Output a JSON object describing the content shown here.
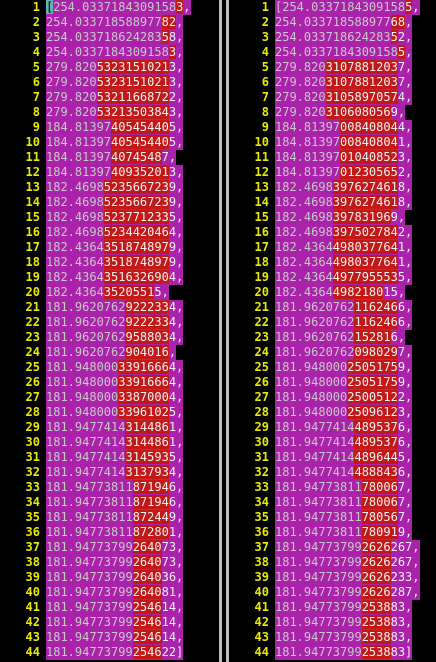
{
  "left": {
    "lines": [
      {
        "n": "1",
        "prefix": "[",
        "same": "254.0337184309158",
        "diff": "3",
        "tail": ","
      },
      {
        "n": "2",
        "prefix": "",
        "same": "254.033718588977",
        "diff": "82",
        "tail": ","
      },
      {
        "n": "3",
        "prefix": "",
        "same": "254.033718624283",
        "diff": "5",
        "tail": "8,"
      },
      {
        "n": "4",
        "prefix": "",
        "same": "254.0337184309158",
        "diff": "3",
        "tail": ","
      },
      {
        "n": "5",
        "prefix": "",
        "same": "279.820",
        "diff": "5323151021",
        "tail": "3,"
      },
      {
        "n": "6",
        "prefix": "",
        "same": "279.820",
        "diff": "5323151021",
        "tail": "3,"
      },
      {
        "n": "7",
        "prefix": "",
        "same": "279.820",
        "diff": "5321166872",
        "tail": "2,"
      },
      {
        "n": "8",
        "prefix": "",
        "same": "279.820",
        "diff": "5321350384",
        "tail": "3,"
      },
      {
        "n": "9",
        "prefix": "",
        "same": "184.81397",
        "diff": "40545440",
        "tail": "5,"
      },
      {
        "n": "10",
        "prefix": "",
        "same": "184.81397",
        "diff": "40545440",
        "tail": "5,"
      },
      {
        "n": "11",
        "prefix": "",
        "same": "184.81397",
        "diff": "4074548",
        "tail": "7,"
      },
      {
        "n": "12",
        "prefix": "",
        "same": "184.81397",
        "diff": "40935201",
        "tail": "3,"
      },
      {
        "n": "13",
        "prefix": "",
        "same": "182.4698",
        "diff": "523566723",
        "tail": "9,"
      },
      {
        "n": "14",
        "prefix": "",
        "same": "182.4698",
        "diff": "523566723",
        "tail": "9,"
      },
      {
        "n": "15",
        "prefix": "",
        "same": "182.4698",
        "diff": "523771233",
        "tail": "5,"
      },
      {
        "n": "16",
        "prefix": "",
        "same": "182.4698",
        "diff": "523442046",
        "tail": "4,"
      },
      {
        "n": "17",
        "prefix": "",
        "same": "182.4364",
        "diff": "351874897",
        "tail": "9,"
      },
      {
        "n": "18",
        "prefix": "",
        "same": "182.4364",
        "diff": "351874897",
        "tail": "9,"
      },
      {
        "n": "19",
        "prefix": "",
        "same": "182.4364",
        "diff": "351632690",
        "tail": "4,"
      },
      {
        "n": "20",
        "prefix": "",
        "same": "182.4364",
        "diff": "3520551",
        "tail": "5,"
      },
      {
        "n": "21",
        "prefix": "",
        "same": "181.9620762",
        "diff": "922233",
        "tail": "4,"
      },
      {
        "n": "22",
        "prefix": "",
        "same": "181.9620762",
        "diff": "922233",
        "tail": "4,"
      },
      {
        "n": "23",
        "prefix": "",
        "same": "181.9620762",
        "diff": "958803",
        "tail": "4,"
      },
      {
        "n": "24",
        "prefix": "",
        "same": "181.9620762",
        "diff": "904016",
        "tail": ","
      },
      {
        "n": "25",
        "prefix": "",
        "same": "181.948000",
        "diff": "3391666",
        "tail": "4,"
      },
      {
        "n": "26",
        "prefix": "",
        "same": "181.948000",
        "diff": "3391666",
        "tail": "4,"
      },
      {
        "n": "27",
        "prefix": "",
        "same": "181.948000",
        "diff": "3387000",
        "tail": "4,"
      },
      {
        "n": "28",
        "prefix": "",
        "same": "181.948000",
        "diff": "3396102",
        "tail": "5,"
      },
      {
        "n": "29",
        "prefix": "",
        "same": "181.9477414",
        "diff": "314486",
        "tail": "1,"
      },
      {
        "n": "30",
        "prefix": "",
        "same": "181.9477414",
        "diff": "314486",
        "tail": "1,"
      },
      {
        "n": "31",
        "prefix": "",
        "same": "181.9477414",
        "diff": "314593",
        "tail": "5,"
      },
      {
        "n": "32",
        "prefix": "",
        "same": "181.9477414",
        "diff": "313793",
        "tail": "4,"
      },
      {
        "n": "33",
        "prefix": "",
        "same": "181.94773811",
        "diff": "87194",
        "tail": "6,"
      },
      {
        "n": "34",
        "prefix": "",
        "same": "181.94773811",
        "diff": "87194",
        "tail": "6,"
      },
      {
        "n": "35",
        "prefix": "",
        "same": "181.94773811",
        "diff": "87244",
        "tail": "9,"
      },
      {
        "n": "36",
        "prefix": "",
        "same": "181.94773811",
        "diff": "87280",
        "tail": "1,"
      },
      {
        "n": "37",
        "prefix": "",
        "same": "181.94773799",
        "diff": "2640",
        "tail": "73,"
      },
      {
        "n": "38",
        "prefix": "",
        "same": "181.94773799",
        "diff": "2640",
        "tail": "73,"
      },
      {
        "n": "39",
        "prefix": "",
        "same": "181.94773799",
        "diff": "2640",
        "tail": "36,"
      },
      {
        "n": "40",
        "prefix": "",
        "same": "181.94773799",
        "diff": "2640",
        "tail": "81,"
      },
      {
        "n": "41",
        "prefix": "",
        "same": "181.94773799",
        "diff": "2546",
        "tail": "14,"
      },
      {
        "n": "42",
        "prefix": "",
        "same": "181.94773799",
        "diff": "2546",
        "tail": "14,"
      },
      {
        "n": "43",
        "prefix": "",
        "same": "181.94773799",
        "diff": "2546",
        "tail": "14,"
      },
      {
        "n": "44",
        "prefix": "",
        "same": "181.94773799",
        "diff": "2546",
        "tail": "22]"
      }
    ]
  },
  "right": {
    "lines": [
      {
        "n": "1",
        "prefix": "[",
        "same": "254.0337184309158",
        "diff": "5",
        "tail": ","
      },
      {
        "n": "2",
        "prefix": "",
        "same": "254.033718588977",
        "diff": "68",
        "tail": ","
      },
      {
        "n": "3",
        "prefix": "",
        "same": "254.033718624283",
        "diff": "5",
        "tail": "2,"
      },
      {
        "n": "4",
        "prefix": "",
        "same": "254.0337184309158",
        "diff": "5",
        "tail": ","
      },
      {
        "n": "5",
        "prefix": "",
        "same": "279.820",
        "diff": "3107881203",
        "tail": "7,"
      },
      {
        "n": "6",
        "prefix": "",
        "same": "279.820",
        "diff": "3107881203",
        "tail": "7,"
      },
      {
        "n": "7",
        "prefix": "",
        "same": "279.820",
        "diff": "3105897057",
        "tail": "4,"
      },
      {
        "n": "8",
        "prefix": "",
        "same": "279.820",
        "diff": "310608056",
        "tail": "9,"
      },
      {
        "n": "9",
        "prefix": "",
        "same": "184.81397",
        "diff": "00840804",
        "tail": "4,"
      },
      {
        "n": "10",
        "prefix": "",
        "same": "184.81397",
        "diff": "00840804",
        "tail": "1,"
      },
      {
        "n": "11",
        "prefix": "",
        "same": "184.81397",
        "diff": "01040852",
        "tail": "3,"
      },
      {
        "n": "12",
        "prefix": "",
        "same": "184.81397",
        "diff": "01230565",
        "tail": "2,"
      },
      {
        "n": "13",
        "prefix": "",
        "same": "182.4698",
        "diff": "397627461",
        "tail": "8,"
      },
      {
        "n": "14",
        "prefix": "",
        "same": "182.4698",
        "diff": "397627461",
        "tail": "8,"
      },
      {
        "n": "15",
        "prefix": "",
        "same": "182.4698",
        "diff": "39783196",
        "tail": "9,"
      },
      {
        "n": "16",
        "prefix": "",
        "same": "182.4698",
        "diff": "397502784",
        "tail": "2,"
      },
      {
        "n": "17",
        "prefix": "",
        "same": "182.4364",
        "diff": "498037764",
        "tail": "1,"
      },
      {
        "n": "18",
        "prefix": "",
        "same": "182.4364",
        "diff": "498037764",
        "tail": "1,"
      },
      {
        "n": "19",
        "prefix": "",
        "same": "182.4364",
        "diff": "497795553",
        "tail": "5,"
      },
      {
        "n": "20",
        "prefix": "",
        "same": "182.4364",
        "diff": "4982180",
        "tail": "15,"
      },
      {
        "n": "21",
        "prefix": "",
        "same": "181.9620762",
        "diff": "116246",
        "tail": "6,"
      },
      {
        "n": "22",
        "prefix": "",
        "same": "181.9620762",
        "diff": "116246",
        "tail": "6,"
      },
      {
        "n": "23",
        "prefix": "",
        "same": "181.9620762",
        "diff": "15281",
        "tail": "6,"
      },
      {
        "n": "24",
        "prefix": "",
        "same": "181.9620762",
        "diff": "098029",
        "tail": "7,"
      },
      {
        "n": "25",
        "prefix": "",
        "same": "181.948000",
        "diff": "2505175",
        "tail": "9,"
      },
      {
        "n": "26",
        "prefix": "",
        "same": "181.948000",
        "diff": "2505175",
        "tail": "9,"
      },
      {
        "n": "27",
        "prefix": "",
        "same": "181.948000",
        "diff": "2500512",
        "tail": "2,"
      },
      {
        "n": "28",
        "prefix": "",
        "same": "181.948000",
        "diff": "2509612",
        "tail": "3,"
      },
      {
        "n": "29",
        "prefix": "",
        "same": "181.9477414",
        "diff": "489537",
        "tail": "6,"
      },
      {
        "n": "30",
        "prefix": "",
        "same": "181.9477414",
        "diff": "489537",
        "tail": "6,"
      },
      {
        "n": "31",
        "prefix": "",
        "same": "181.9477414",
        "diff": "489644",
        "tail": "5,"
      },
      {
        "n": "32",
        "prefix": "",
        "same": "181.9477414",
        "diff": "488843",
        "tail": "6,"
      },
      {
        "n": "33",
        "prefix": "",
        "same": "181.94773811",
        "diff": "78006",
        "tail": "7,"
      },
      {
        "n": "34",
        "prefix": "",
        "same": "181.94773811",
        "diff": "78006",
        "tail": "7,"
      },
      {
        "n": "35",
        "prefix": "",
        "same": "181.94773811",
        "diff": "78056",
        "tail": "7,"
      },
      {
        "n": "36",
        "prefix": "",
        "same": "181.94773811",
        "diff": "78091",
        "tail": "9,"
      },
      {
        "n": "37",
        "prefix": "",
        "same": "181.94773799",
        "diff": "2626",
        "tail": "267,"
      },
      {
        "n": "38",
        "prefix": "",
        "same": "181.94773799",
        "diff": "2626",
        "tail": "267,"
      },
      {
        "n": "39",
        "prefix": "",
        "same": "181.94773799",
        "diff": "2626",
        "tail": "233,"
      },
      {
        "n": "40",
        "prefix": "",
        "same": "181.94773799",
        "diff": "2626",
        "tail": "287,"
      },
      {
        "n": "41",
        "prefix": "",
        "same": "181.94773799",
        "diff": "2538",
        "tail": "83,"
      },
      {
        "n": "42",
        "prefix": "",
        "same": "181.94773799",
        "diff": "2538",
        "tail": "83,"
      },
      {
        "n": "43",
        "prefix": "",
        "same": "181.94773799",
        "diff": "2538",
        "tail": "83,"
      },
      {
        "n": "44",
        "prefix": "",
        "same": "181.94773799",
        "diff": "2538",
        "tail": "83]"
      }
    ]
  },
  "colors": {
    "background": "#000000",
    "line_number": "#e8e800",
    "changed_line_bg": "#aa22aa",
    "changed_text_bg": "#c21818",
    "cursor": "#5fb4b4"
  }
}
